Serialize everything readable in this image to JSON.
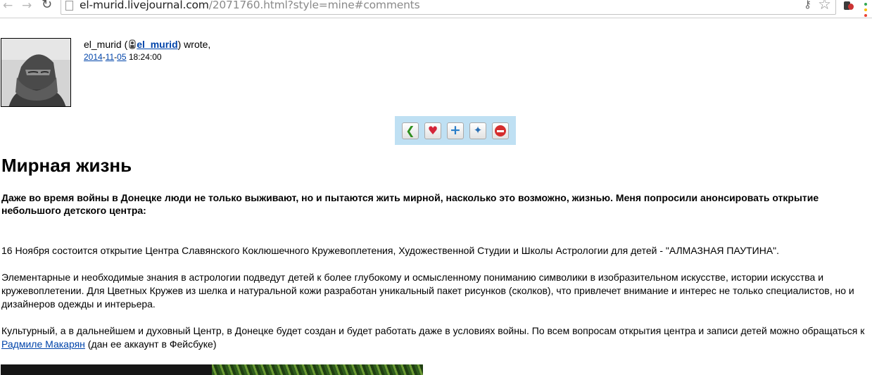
{
  "browser": {
    "url_host": "el-murid.livejournal.com",
    "url_path": "/2071760.html?style=mine#comments",
    "icons": [
      "back-arrow-icon",
      "forward-arrow-icon",
      "reload-icon",
      "page-icon",
      "key-icon",
      "star-icon",
      "extension-icon",
      "menu-icon"
    ],
    "menu_dot_colors": [
      "#34a853",
      "#fbbc05",
      "#ea4335"
    ]
  },
  "entry": {
    "author_name": "el_murid",
    "author_open": " (",
    "author_link": "el_murid",
    "author_close": ") wrote,",
    "date": {
      "year": "2014",
      "month": "11",
      "day": "05",
      "time": "18:24:00",
      "sep": "-"
    },
    "actions": [
      "prev-entry",
      "add-to-memories",
      "add-entry",
      "tag-entry",
      "delete-entry"
    ],
    "title": "Мирная жизнь",
    "lead": "Даже во время войны в Донецке люди не только выживают, но и пытаются жить мирной, насколько это возможно, жизнью. Меня попросили анонсировать открытие небольшого детского центра:",
    "p1": "16 Ноября состоится открытие Центра Славянского Коклюшечного Кружевоплетения, Художественной Студии и Школы Астрологии для детей - \"АЛМАЗНАЯ ПАУТИНА\".",
    "p2": "Элементарные и необходимые знания в астрологии подведут детей к более глубокому и осмысленному пониманию символики в изобразительном искусстве, истории искусства и кружевоплетении. Для Цветных Кружев из шелка и натуральной кожи разработан уникальный пакет рисунков (сколков), что привлечет внимание и интерес не только специалистов, но и дизайнеров одежды и интерьера.",
    "p3_before": "Культурный, а в дальнейшем и духовный Центр, в Донецке будет создан и будет работать даже в условиях войны. По всем вопросам открытия центра и записи детей можно обращаться к ",
    "p3_link": "Радмиле Макарян",
    "p3_after": " (дан ее аккаунт в Фейсбуке)"
  },
  "colors": {
    "link": "#0044aa",
    "action_bar": "#bfe0f3"
  }
}
